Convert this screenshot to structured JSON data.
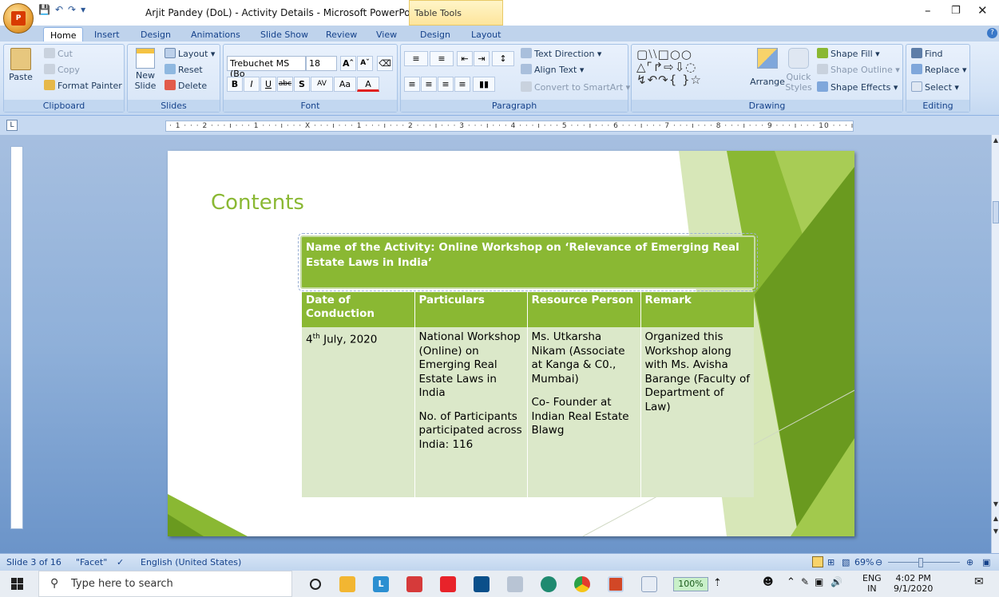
{
  "titlebar": {
    "title": "Arjit Pandey (DoL) - Activity Details - Microsoft PowerPoint",
    "context_tab": "Table Tools"
  },
  "tabs": [
    "Home",
    "Insert",
    "Design",
    "Animations",
    "Slide Show",
    "Review",
    "View",
    "Design",
    "Layout"
  ],
  "ribbon": {
    "clipboard": {
      "cut": "Cut",
      "copy": "Copy",
      "format_painter": "Format Painter",
      "paste": "Paste",
      "label": "Clipboard"
    },
    "slides": {
      "layout": "Layout",
      "reset": "Reset",
      "delete": "Delete",
      "new_slide": "New",
      "new_slide2": "Slide",
      "label": "Slides"
    },
    "font": {
      "name": "Trebuchet MS (Bo",
      "size": "18",
      "label": "Font"
    },
    "paragraph": {
      "text_direction": "Text Direction",
      "align_text": "Align Text",
      "convert_smartart": "Convert to SmartArt",
      "label": "Paragraph"
    },
    "drawing": {
      "shape_fill": "Shape Fill",
      "shape_outline": "Shape Outline",
      "shape_effects": "Shape Effects",
      "arrange": "Arrange",
      "quick_styles": "Quick",
      "quick_styles2": "Styles",
      "label": "Drawing"
    },
    "editing": {
      "find": "Find",
      "replace": "Replace",
      "select": "Select",
      "label": "Editing"
    }
  },
  "ruler_text": "· 1 · · · 2 · · · ı · · · 1 · · · ı · · · X · · · ı · · · 1 · · · ı · · · 2 · · · ı · · · 3 · · · ı · · · 4 · · · ı · · · 5 · · · ı · · · 6 · · · ı · · · 7 · · · ı · · · 8 · · · ı · · · 9 · · · ı · · · 10 · · · ı",
  "slide": {
    "title": "Contents",
    "name_box": "Name of the Activity: Online Workshop on ‘Relevance of Emerging Real Estate Laws in India’",
    "headers": [
      "Date of Conduction",
      "Particulars",
      "Resource Person",
      "Remark"
    ],
    "date_day": "4",
    "date_sup": "th",
    "date_rest": " July, 2020",
    "particulars_1": "National Workshop (Online) on Emerging Real Estate Laws in India",
    "particulars_2": "No. of Participants participated across India: 116",
    "resource_1": "Ms. Utkarsha Nikam (Associate at Kanga & C0., Mumbai)",
    "resource_2": "Co- Founder at Indian Real Estate Blawg",
    "remark": "Organized this Workshop along with Ms. Avisha Barange (Faculty of Department of Law)"
  },
  "status": {
    "slide": "Slide 3 of 16",
    "theme": "\"Facet\"",
    "language": "English (United States)",
    "zoom": "69%"
  },
  "taskbar": {
    "search_placeholder": "Type here to search",
    "zoom_badge": "100%",
    "lang1": "ENG",
    "lang2": "IN",
    "time": "4:02 PM",
    "date": "9/1/2020"
  },
  "colors": {
    "accent_green": "#8ab833",
    "cell_green": "#dbe8c9"
  }
}
